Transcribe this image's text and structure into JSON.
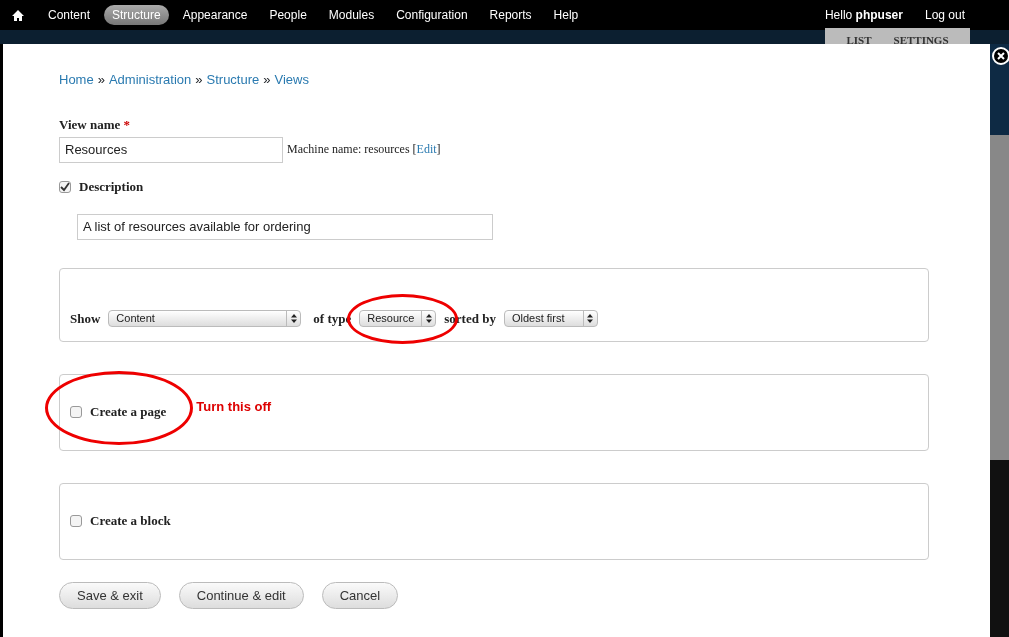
{
  "toolbar": {
    "menu": [
      {
        "label": "Content",
        "selected": false
      },
      {
        "label": "Structure",
        "selected": true
      },
      {
        "label": "Appearance",
        "selected": false
      },
      {
        "label": "People",
        "selected": false
      },
      {
        "label": "Modules",
        "selected": false
      },
      {
        "label": "Configuration",
        "selected": false
      },
      {
        "label": "Reports",
        "selected": false
      },
      {
        "label": "Help",
        "selected": false
      }
    ],
    "greeting": "Hello",
    "user": "phpuser",
    "logout": "Log out"
  },
  "background_tabs": [
    "LIST",
    "SETTINGS"
  ],
  "breadcrumb": {
    "separator": "»",
    "items": [
      "Home",
      "Administration",
      "Structure",
      "Views"
    ]
  },
  "view_name": {
    "label": "View name",
    "required_mark": "*",
    "value": "Resources",
    "machine_name": "Machine name: resources",
    "bracket_open": "[",
    "edit_link": "Edit",
    "bracket_close": "]"
  },
  "description": {
    "label": "Description",
    "checked": true,
    "value": "A list of resources available for ordering"
  },
  "show": {
    "label": "Show",
    "select": "Content",
    "type_label": "of type",
    "type_select": "Resource",
    "sort_label": "sorted by",
    "sort_select": "Oldest first"
  },
  "options": [
    {
      "label": "Create a page",
      "checked": false,
      "annotation": "Turn this off"
    },
    {
      "label": "Create a block",
      "checked": false
    }
  ],
  "buttons": [
    "Save & exit",
    "Continue & edit",
    "Cancel"
  ]
}
